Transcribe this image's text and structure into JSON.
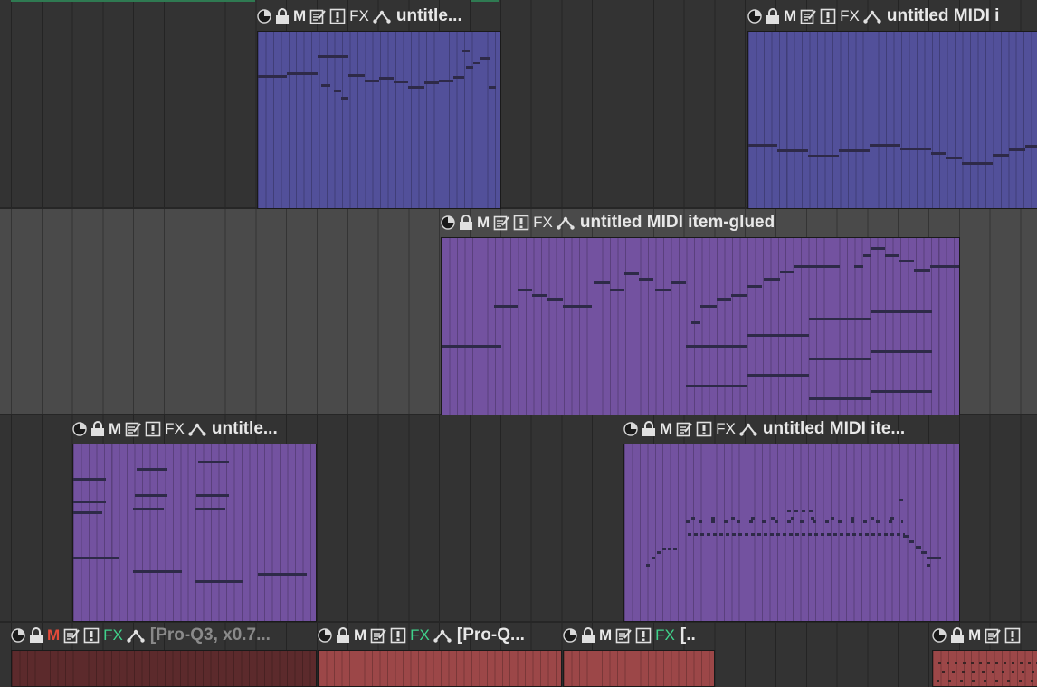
{
  "colors": {
    "blue_item": "#52509a",
    "purple_item": "#7352a0",
    "red_item_dark": "#5c2a2c",
    "red_item": "#9c4748",
    "note": "#2e2a48",
    "fx_green": "#3fd38b",
    "mute_red": "#e24a3a"
  },
  "icons": [
    "volume-knob-icon",
    "lock-icon",
    "mute-icon",
    "notes-icon",
    "take-icon",
    "fx-icon",
    "envelope-icon"
  ],
  "buttons": {
    "mute": "M",
    "fx": "FX"
  },
  "items": [
    {
      "id": "item-1",
      "title": "untitle..."
    },
    {
      "id": "item-2",
      "title": "untitled MIDI i"
    },
    {
      "id": "item-3",
      "title": "untitled MIDI item-glued"
    },
    {
      "id": "item-4",
      "title": "untitle..."
    },
    {
      "id": "item-5",
      "title": "untitled MIDI ite..."
    },
    {
      "id": "item-6",
      "title": "[Pro-Q3,  x0.7..."
    },
    {
      "id": "item-7",
      "title": "[Pro-Q..."
    },
    {
      "id": "item-8",
      "title": "[.."
    },
    {
      "id": "item-9",
      "title": ""
    }
  ]
}
